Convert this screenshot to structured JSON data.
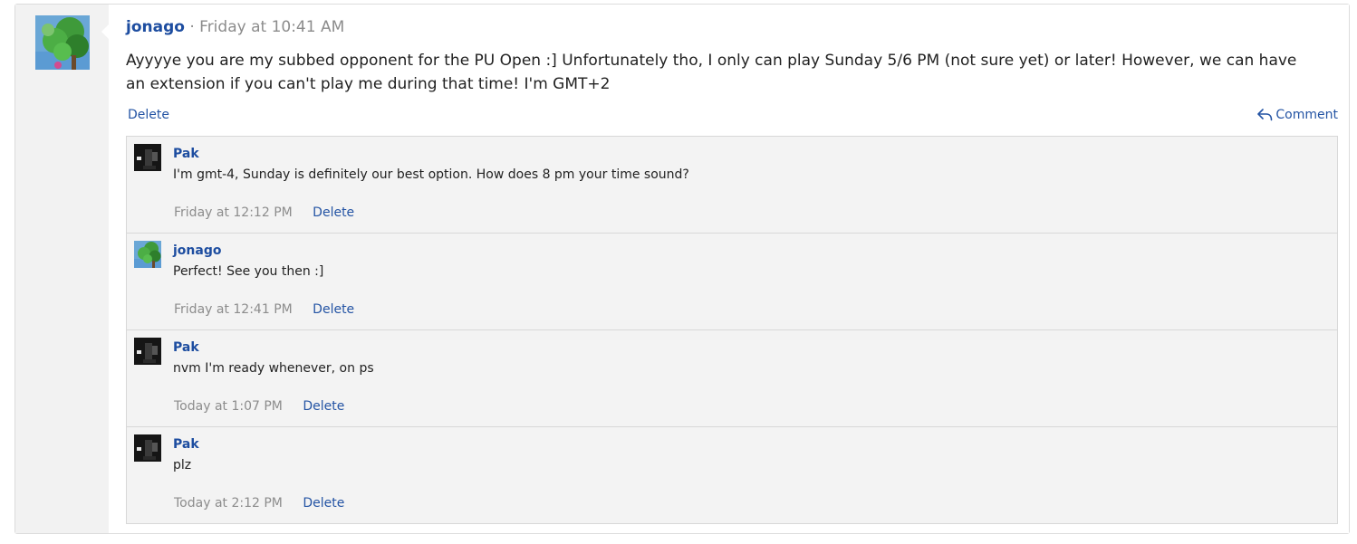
{
  "post": {
    "username": "jonago",
    "separator": "·",
    "time": "Friday at 10:41 AM",
    "body": "Ayyyye you are my subbed opponent for the PU Open :] Unfortunately tho, I only can play Sunday 5/6 PM (not sure yet) or later! However, we can have an extension if you can't play me during that time! I'm GMT+2",
    "delete_label": "Delete",
    "comment_label": "Comment",
    "comment_icon": "reply-arrow-icon",
    "avatar_icon": "green-tree-avatar"
  },
  "comments": [
    {
      "username": "Pak",
      "text": "I'm gmt-4, Sunday is definitely our best option. How does 8 pm your time sound?",
      "time": "Friday at 12:12 PM",
      "delete_label": "Delete",
      "avatar_icon": "dark-avatar"
    },
    {
      "username": "jonago",
      "text": "Perfect! See you then :]",
      "time": "Friday at 12:41 PM",
      "delete_label": "Delete",
      "avatar_icon": "green-tree-avatar"
    },
    {
      "username": "Pak",
      "text": "nvm I'm ready whenever, on ps",
      "time": "Today at 1:07 PM",
      "delete_label": "Delete",
      "avatar_icon": "dark-avatar"
    },
    {
      "username": "Pak",
      "text": "plz",
      "time": "Today at 2:12 PM",
      "delete_label": "Delete",
      "avatar_icon": "dark-avatar"
    }
  ],
  "colors": {
    "link": "#2454a4",
    "username": "#1d4da0",
    "muted": "#8c8c8c",
    "comment_bg": "#f3f3f3"
  }
}
